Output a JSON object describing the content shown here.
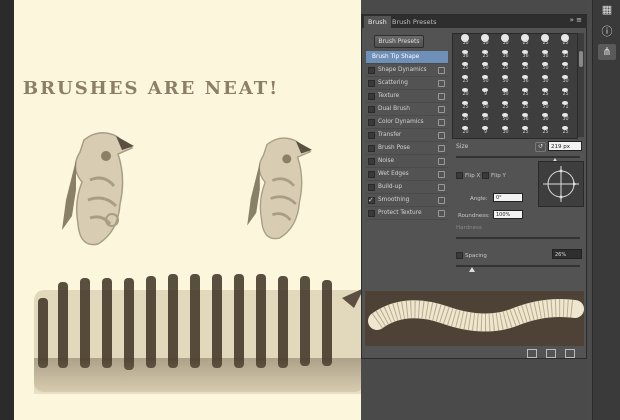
{
  "canvas": {
    "title": "BRUSHES ARE NEAT!"
  },
  "panel": {
    "tabs": [
      "Brush",
      "Brush Presets"
    ],
    "menu_glyph": "»  ≡",
    "presets_button": "Brush Presets",
    "options": [
      {
        "label": "Brush Tip Shape",
        "selected": true,
        "checked": false,
        "lock": false
      },
      {
        "label": "Shape Dynamics",
        "selected": false,
        "checked": false,
        "lock": true
      },
      {
        "label": "Scattering",
        "selected": false,
        "checked": false,
        "lock": true
      },
      {
        "label": "Texture",
        "selected": false,
        "checked": false,
        "lock": true
      },
      {
        "label": "Dual Brush",
        "selected": false,
        "checked": false,
        "lock": true
      },
      {
        "label": "Color Dynamics",
        "selected": false,
        "checked": false,
        "lock": true
      },
      {
        "label": "Transfer",
        "selected": false,
        "checked": false,
        "lock": true
      },
      {
        "label": "Brush Pose",
        "selected": false,
        "checked": false,
        "lock": true
      },
      {
        "label": "Noise",
        "selected": false,
        "checked": false,
        "lock": true
      },
      {
        "label": "Wet Edges",
        "selected": false,
        "checked": false,
        "lock": true
      },
      {
        "label": "Build-up",
        "selected": false,
        "checked": false,
        "lock": true
      },
      {
        "label": "Smoothing",
        "selected": false,
        "checked": true,
        "lock": true
      },
      {
        "label": "Protect Texture",
        "selected": false,
        "checked": false,
        "lock": true
      }
    ],
    "preset_grid": [
      [
        "30",
        "30",
        "30",
        "25",
        "25",
        "25"
      ],
      [
        "36",
        "25",
        "36",
        "36",
        "36",
        "32"
      ],
      [
        "25",
        "50",
        "25",
        "25",
        "50",
        "71"
      ],
      [
        "25",
        "50",
        "50",
        "36",
        "30",
        "30"
      ],
      [
        "20",
        "9",
        "30",
        "25",
        "25",
        "25"
      ],
      [
        "25",
        "50",
        "25",
        "25",
        "50",
        "71"
      ],
      [
        "25",
        "50",
        "50",
        "36",
        "30",
        "30"
      ],
      [
        "20",
        "9",
        "30",
        "25",
        "25",
        "25"
      ]
    ],
    "size_label": "Size",
    "size_value": "219 px",
    "flip_x": "Flip X",
    "flip_y": "Flip Y",
    "angle_label": "Angle:",
    "angle_value": "0°",
    "roundness_label": "Roundness:",
    "roundness_value": "100%",
    "hardness_label": "Hardness",
    "spacing_label": "Spacing",
    "spacing_value": "26%"
  }
}
